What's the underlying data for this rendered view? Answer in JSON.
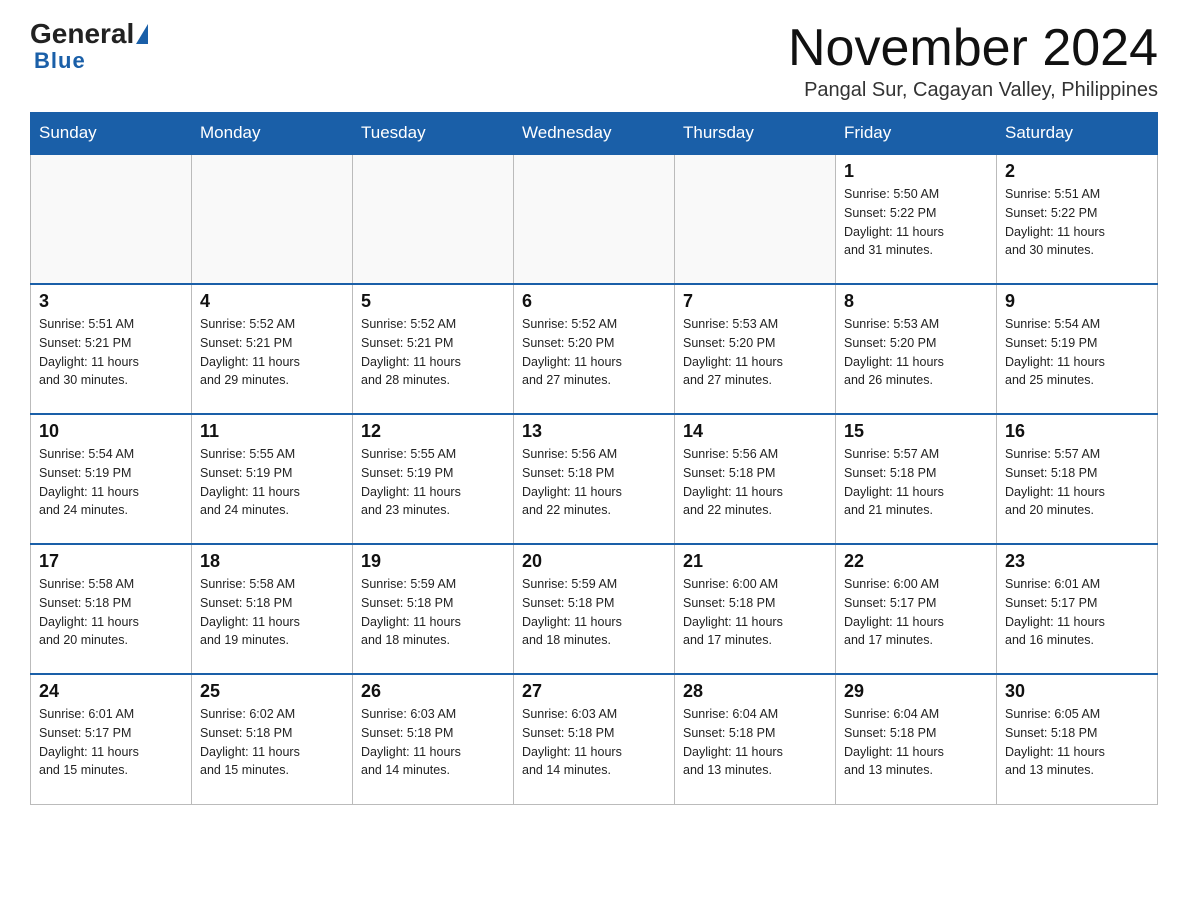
{
  "logo": {
    "general": "General",
    "blue": "Blue"
  },
  "header": {
    "month_year": "November 2024",
    "location": "Pangal Sur, Cagayan Valley, Philippines"
  },
  "weekdays": [
    "Sunday",
    "Monday",
    "Tuesday",
    "Wednesday",
    "Thursday",
    "Friday",
    "Saturday"
  ],
  "weeks": [
    [
      {
        "day": "",
        "info": ""
      },
      {
        "day": "",
        "info": ""
      },
      {
        "day": "",
        "info": ""
      },
      {
        "day": "",
        "info": ""
      },
      {
        "day": "",
        "info": ""
      },
      {
        "day": "1",
        "info": "Sunrise: 5:50 AM\nSunset: 5:22 PM\nDaylight: 11 hours\nand 31 minutes."
      },
      {
        "day": "2",
        "info": "Sunrise: 5:51 AM\nSunset: 5:22 PM\nDaylight: 11 hours\nand 30 minutes."
      }
    ],
    [
      {
        "day": "3",
        "info": "Sunrise: 5:51 AM\nSunset: 5:21 PM\nDaylight: 11 hours\nand 30 minutes."
      },
      {
        "day": "4",
        "info": "Sunrise: 5:52 AM\nSunset: 5:21 PM\nDaylight: 11 hours\nand 29 minutes."
      },
      {
        "day": "5",
        "info": "Sunrise: 5:52 AM\nSunset: 5:21 PM\nDaylight: 11 hours\nand 28 minutes."
      },
      {
        "day": "6",
        "info": "Sunrise: 5:52 AM\nSunset: 5:20 PM\nDaylight: 11 hours\nand 27 minutes."
      },
      {
        "day": "7",
        "info": "Sunrise: 5:53 AM\nSunset: 5:20 PM\nDaylight: 11 hours\nand 27 minutes."
      },
      {
        "day": "8",
        "info": "Sunrise: 5:53 AM\nSunset: 5:20 PM\nDaylight: 11 hours\nand 26 minutes."
      },
      {
        "day": "9",
        "info": "Sunrise: 5:54 AM\nSunset: 5:19 PM\nDaylight: 11 hours\nand 25 minutes."
      }
    ],
    [
      {
        "day": "10",
        "info": "Sunrise: 5:54 AM\nSunset: 5:19 PM\nDaylight: 11 hours\nand 24 minutes."
      },
      {
        "day": "11",
        "info": "Sunrise: 5:55 AM\nSunset: 5:19 PM\nDaylight: 11 hours\nand 24 minutes."
      },
      {
        "day": "12",
        "info": "Sunrise: 5:55 AM\nSunset: 5:19 PM\nDaylight: 11 hours\nand 23 minutes."
      },
      {
        "day": "13",
        "info": "Sunrise: 5:56 AM\nSunset: 5:18 PM\nDaylight: 11 hours\nand 22 minutes."
      },
      {
        "day": "14",
        "info": "Sunrise: 5:56 AM\nSunset: 5:18 PM\nDaylight: 11 hours\nand 22 minutes."
      },
      {
        "day": "15",
        "info": "Sunrise: 5:57 AM\nSunset: 5:18 PM\nDaylight: 11 hours\nand 21 minutes."
      },
      {
        "day": "16",
        "info": "Sunrise: 5:57 AM\nSunset: 5:18 PM\nDaylight: 11 hours\nand 20 minutes."
      }
    ],
    [
      {
        "day": "17",
        "info": "Sunrise: 5:58 AM\nSunset: 5:18 PM\nDaylight: 11 hours\nand 20 minutes."
      },
      {
        "day": "18",
        "info": "Sunrise: 5:58 AM\nSunset: 5:18 PM\nDaylight: 11 hours\nand 19 minutes."
      },
      {
        "day": "19",
        "info": "Sunrise: 5:59 AM\nSunset: 5:18 PM\nDaylight: 11 hours\nand 18 minutes."
      },
      {
        "day": "20",
        "info": "Sunrise: 5:59 AM\nSunset: 5:18 PM\nDaylight: 11 hours\nand 18 minutes."
      },
      {
        "day": "21",
        "info": "Sunrise: 6:00 AM\nSunset: 5:18 PM\nDaylight: 11 hours\nand 17 minutes."
      },
      {
        "day": "22",
        "info": "Sunrise: 6:00 AM\nSunset: 5:17 PM\nDaylight: 11 hours\nand 17 minutes."
      },
      {
        "day": "23",
        "info": "Sunrise: 6:01 AM\nSunset: 5:17 PM\nDaylight: 11 hours\nand 16 minutes."
      }
    ],
    [
      {
        "day": "24",
        "info": "Sunrise: 6:01 AM\nSunset: 5:17 PM\nDaylight: 11 hours\nand 15 minutes."
      },
      {
        "day": "25",
        "info": "Sunrise: 6:02 AM\nSunset: 5:18 PM\nDaylight: 11 hours\nand 15 minutes."
      },
      {
        "day": "26",
        "info": "Sunrise: 6:03 AM\nSunset: 5:18 PM\nDaylight: 11 hours\nand 14 minutes."
      },
      {
        "day": "27",
        "info": "Sunrise: 6:03 AM\nSunset: 5:18 PM\nDaylight: 11 hours\nand 14 minutes."
      },
      {
        "day": "28",
        "info": "Sunrise: 6:04 AM\nSunset: 5:18 PM\nDaylight: 11 hours\nand 13 minutes."
      },
      {
        "day": "29",
        "info": "Sunrise: 6:04 AM\nSunset: 5:18 PM\nDaylight: 11 hours\nand 13 minutes."
      },
      {
        "day": "30",
        "info": "Sunrise: 6:05 AM\nSunset: 5:18 PM\nDaylight: 11 hours\nand 13 minutes."
      }
    ]
  ]
}
